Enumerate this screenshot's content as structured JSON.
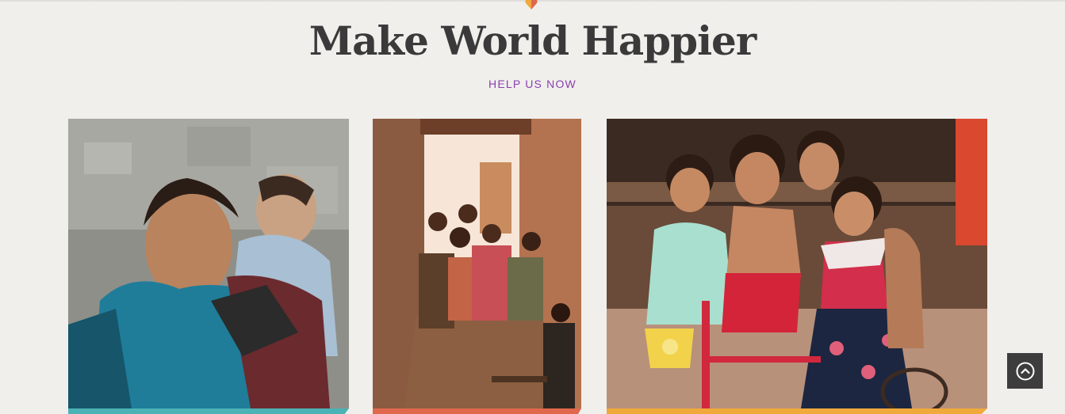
{
  "section": {
    "title": "Make World Happier",
    "subtitle": "HELP US NOW"
  },
  "icons": {
    "heart": "heart-icon",
    "scroll_top": "chevron-up-circle-icon"
  },
  "cards": [
    {
      "name": "mother-with-baby",
      "accent": "#4bb3b5"
    },
    {
      "name": "children-in-window",
      "accent": "#e0684d"
    },
    {
      "name": "children-on-bicycle",
      "accent": "#f0a93b"
    }
  ],
  "colors": {
    "background": "#f0efec",
    "title": "#3a3a3a",
    "subtitle": "#8a3fb0",
    "scroll_button": "#3d3d3d"
  }
}
